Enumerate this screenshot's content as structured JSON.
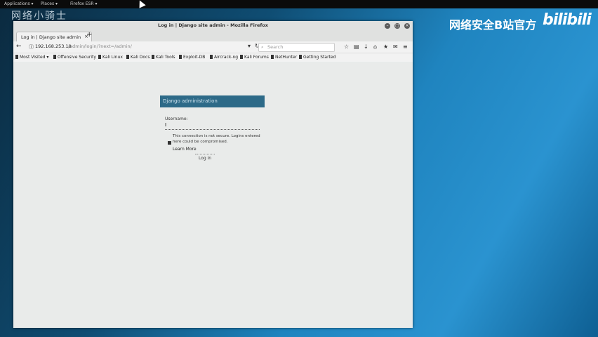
{
  "top_panel": {
    "applications": "Applications ▾",
    "places": "Places ▾",
    "firefox_esr": "Firefox ESR ▾"
  },
  "watermarks": {
    "left": "网络小骑士",
    "right": "网络安全B站官方",
    "logo": "bilibili"
  },
  "browser": {
    "window_title": "Log in | Django site admin - Mozilla Firefox",
    "tab_label": "Log in | Django site admin",
    "url_host": "192.168.253.18",
    "url_path": "/admin/login/?next=/admin/",
    "search_placeholder": "Search",
    "bookmarks": [
      "Most Visited ▾",
      "Offensive Security",
      "Kali Linux",
      "Kali Docs",
      "Kali Tools",
      "Exploit-DB",
      "Aircrack-ng",
      "Kali Forums",
      "NetHunter",
      "Getting Started"
    ]
  },
  "page": {
    "header": "Django administration",
    "username_label": "Username:",
    "username_value": "I",
    "warning": "This connection is not secure. Logins entered here could be compromised.",
    "learn_more": "Learn More",
    "login_button": "Log in"
  }
}
